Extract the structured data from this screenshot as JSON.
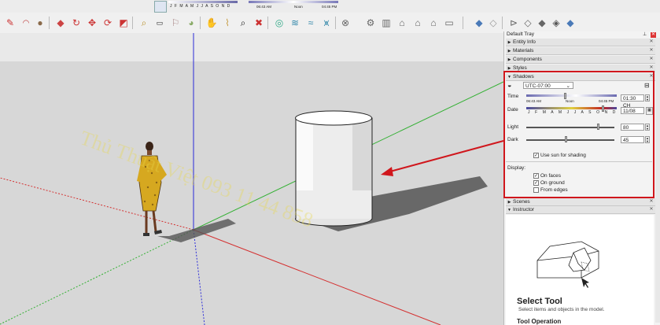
{
  "top_strip": {
    "months": "J F M A M J J A S O N D",
    "time_start": "06:43 AM",
    "time_noon": "Noon",
    "time_end": "04:45 PM"
  },
  "toolbar": {
    "icons": [
      "pencil-icon",
      "arc-icon",
      "paint-circle-icon",
      "paint-bucket-icon",
      "orbit-icon",
      "move-icon",
      "rotate-icon",
      "scale-icon",
      "tape-icon",
      "text-icon",
      "dimension-icon",
      "paint-icon",
      "protractor-icon",
      "zoom-icon",
      "zoom-extents-icon",
      "components-icon",
      "materials-icon",
      "styles-icon",
      "walk-icon",
      "iso-view-icon",
      "top-view-icon",
      "front-view-icon",
      "right-view-icon",
      "back-view-icon",
      "left-view-icon",
      "xray-icon",
      "back-edges-icon",
      "wireframe-icon",
      "hidden-line-icon",
      "shaded-icon",
      "textured-icon",
      "monochrome-icon"
    ]
  },
  "watermark": "Thủ Thuật Việt 093 11 44 858",
  "tray": {
    "title": "Default Tray",
    "sections": [
      {
        "label": "Entity Info",
        "expanded": false
      },
      {
        "label": "Materials",
        "expanded": false
      },
      {
        "label": "Components",
        "expanded": false
      },
      {
        "label": "Styles",
        "expanded": false
      },
      {
        "label": "Shadows",
        "expanded": true
      }
    ],
    "shadows": {
      "timezone": "UTC-07:00",
      "time_label": "Time",
      "time_start": "06:43 AM",
      "time_noon": "Noon",
      "time_end": "04:45 PM",
      "time_value": "01:30 CH",
      "date_label": "Date",
      "months": "J F M A M J J A S O N D",
      "date_value": "11/08",
      "light_label": "Light",
      "light_value": "80",
      "dark_label": "Dark",
      "dark_value": "45",
      "use_sun_label": "Use sun for shading",
      "use_sun_checked": true,
      "display_label": "Display:",
      "on_faces_label": "On faces",
      "on_faces_checked": true,
      "on_ground_label": "On ground",
      "on_ground_checked": true,
      "from_edges_label": "From edges",
      "from_edges_checked": false
    },
    "sections_after": [
      {
        "label": "Scenes",
        "expanded": false
      },
      {
        "label": "Instructor",
        "expanded": true
      }
    ],
    "instructor": {
      "tool_title": "Select Tool",
      "tool_desc": "Select items and objects in the model.",
      "tool_operation": "Tool Operation"
    }
  },
  "colors": {
    "highlight_red": "#d0161c",
    "axis_blue": "#2a2ad8",
    "axis_green": "#33b033",
    "axis_red": "#d43030"
  }
}
